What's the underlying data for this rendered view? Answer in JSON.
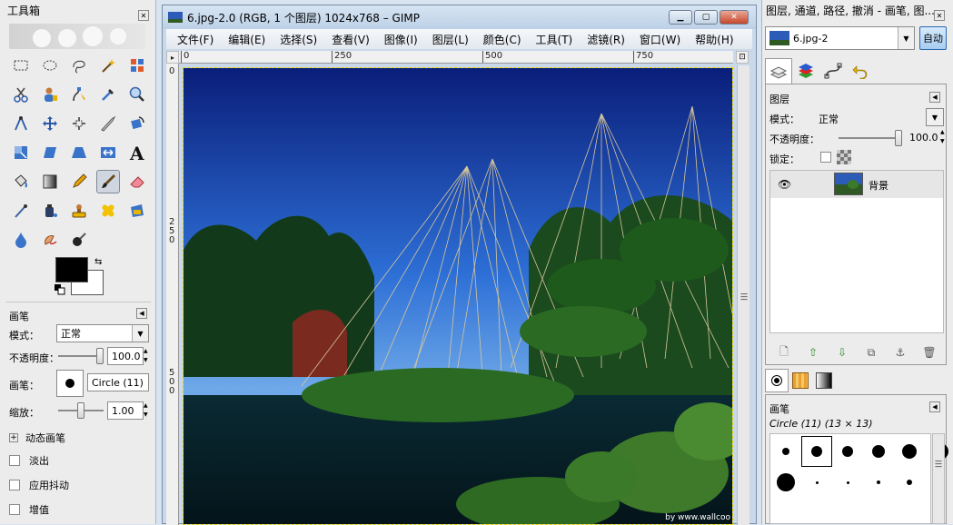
{
  "toolbox": {
    "title": "工具箱",
    "options_title": "画笔",
    "mode_label": "模式：",
    "mode_value": "正常",
    "opacity_label": "不透明度：",
    "opacity_value": "100.0",
    "opacity_fraction": 1.0,
    "brush_label": "画笔：",
    "brush_value": "Circle (11)",
    "scale_label": "缩放：",
    "scale_value": "1.00",
    "scale_fraction": 0.5,
    "dynamic_label": "动态画笔",
    "fade_label": "淡出",
    "jitter_label": "应用抖动",
    "incremental_label": "增值",
    "fg_color": "#000000",
    "bg_color": "#ffffff"
  },
  "image_window": {
    "title": "6.jpg-2.0 (RGB, 1 个图层) 1024x768 – GIMP",
    "menu": [
      "文件(F)",
      "编辑(E)",
      "选择(S)",
      "查看(V)",
      "图像(I)",
      "图层(L)",
      "颜色(C)",
      "工具(T)",
      "滤镜(R)",
      "窗口(W)",
      "帮助(H)"
    ],
    "ruler_h": [
      "0",
      "250",
      "500",
      "750"
    ],
    "ruler_v": [
      "0",
      "250",
      "500"
    ],
    "watermark": "by www.wallcoo"
  },
  "dock": {
    "title": "图层, 通道, 路径, 撤消 - 画笔, 图...",
    "image_select": "6.jpg-2",
    "auto_label": "自动",
    "layers_title": "图层",
    "mode_label": "模式：",
    "mode_value": "正常",
    "opacity_label": "不透明度：",
    "opacity_value": "100.0",
    "opacity_fraction": 1.0,
    "lock_label": "锁定：",
    "layer_name": "背景",
    "brushes_title": "画笔",
    "brush_info": "Circle (11) (13 × 13)"
  }
}
